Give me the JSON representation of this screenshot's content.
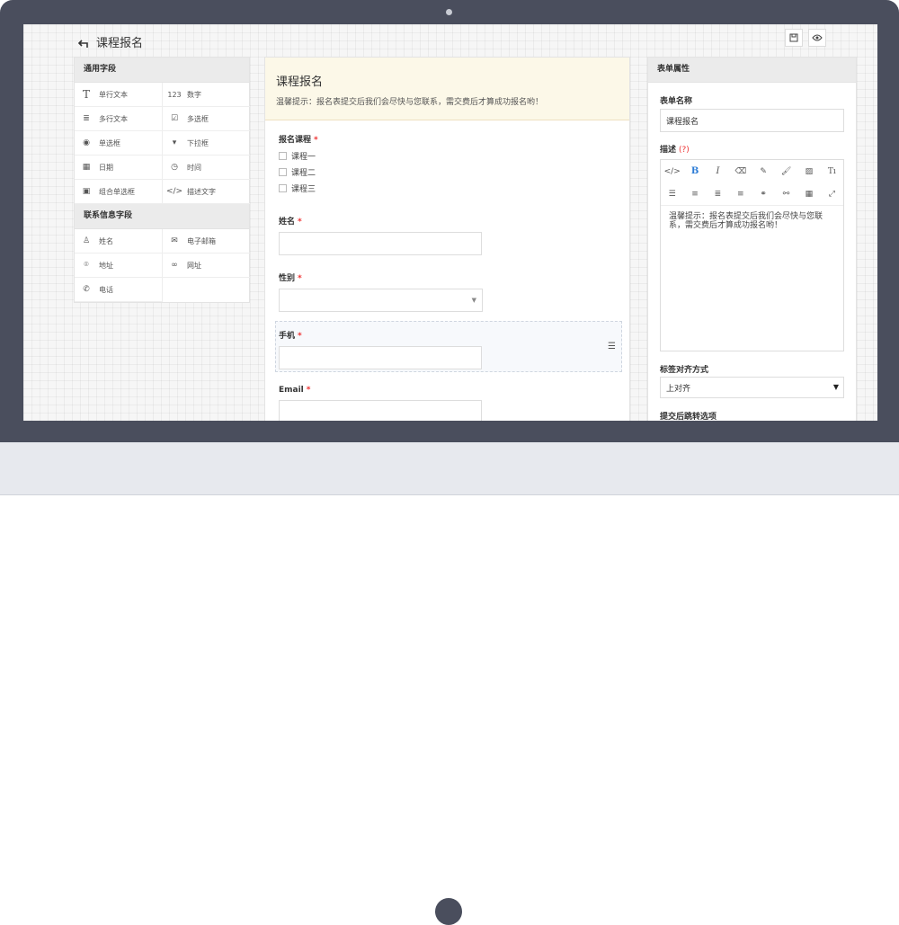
{
  "header": {
    "title": "课程报名"
  },
  "left_panel": {
    "section1": "通用字段",
    "fields1": [
      {
        "label": "单行文本",
        "icon": "text-T-icon"
      },
      {
        "label": "数字",
        "icon": "number-icon"
      },
      {
        "label": "多行文本",
        "icon": "paragraph-icon"
      },
      {
        "label": "多选框",
        "icon": "checkbox-icon"
      },
      {
        "label": "单选框",
        "icon": "radio-icon"
      },
      {
        "label": "下拉框",
        "icon": "dropdown-icon"
      },
      {
        "label": "日期",
        "icon": "calendar-icon"
      },
      {
        "label": "时间",
        "icon": "clock-icon"
      },
      {
        "label": "组合单选框",
        "icon": "grid-radio-icon"
      },
      {
        "label": "描述文字",
        "icon": "code-icon"
      }
    ],
    "section2": "联系信息字段",
    "fields2": [
      {
        "label": "姓名",
        "icon": "user-icon"
      },
      {
        "label": "电子邮箱",
        "icon": "mail-icon"
      },
      {
        "label": "地址",
        "icon": "location-icon"
      },
      {
        "label": "网址",
        "icon": "link-icon"
      },
      {
        "label": "电话",
        "icon": "phone-icon"
      }
    ]
  },
  "form": {
    "heading": "课程报名",
    "notice": "温馨提示：报名表提交后我们会尽快与您联系，需交费后才算成功报名哟！",
    "required_mark": "*",
    "course_label": "报名课程",
    "course_options": [
      "课程一",
      "课程二",
      "课程三"
    ],
    "name_label": "姓名",
    "gender_label": "性别",
    "phone_label": "手机",
    "email_label": "Email"
  },
  "right_panel": {
    "title": "表单属性",
    "form_name_label": "表单名称",
    "form_name_value": "课程报名",
    "desc_label": "描述",
    "desc_help": "(?)",
    "desc_text": "温馨提示：报名表提交后我们会尽快与您联系，需交费后才算成功报名哟！",
    "align_label": "标签对齐方式",
    "align_value": "上对齐",
    "redirect_label": "提交后跳转选项"
  },
  "colors": {
    "bezel": "#4a4e5d",
    "notice_bg": "#fcf8e8",
    "required": "#ee3333",
    "bold_icon": "#2b7bd6"
  }
}
